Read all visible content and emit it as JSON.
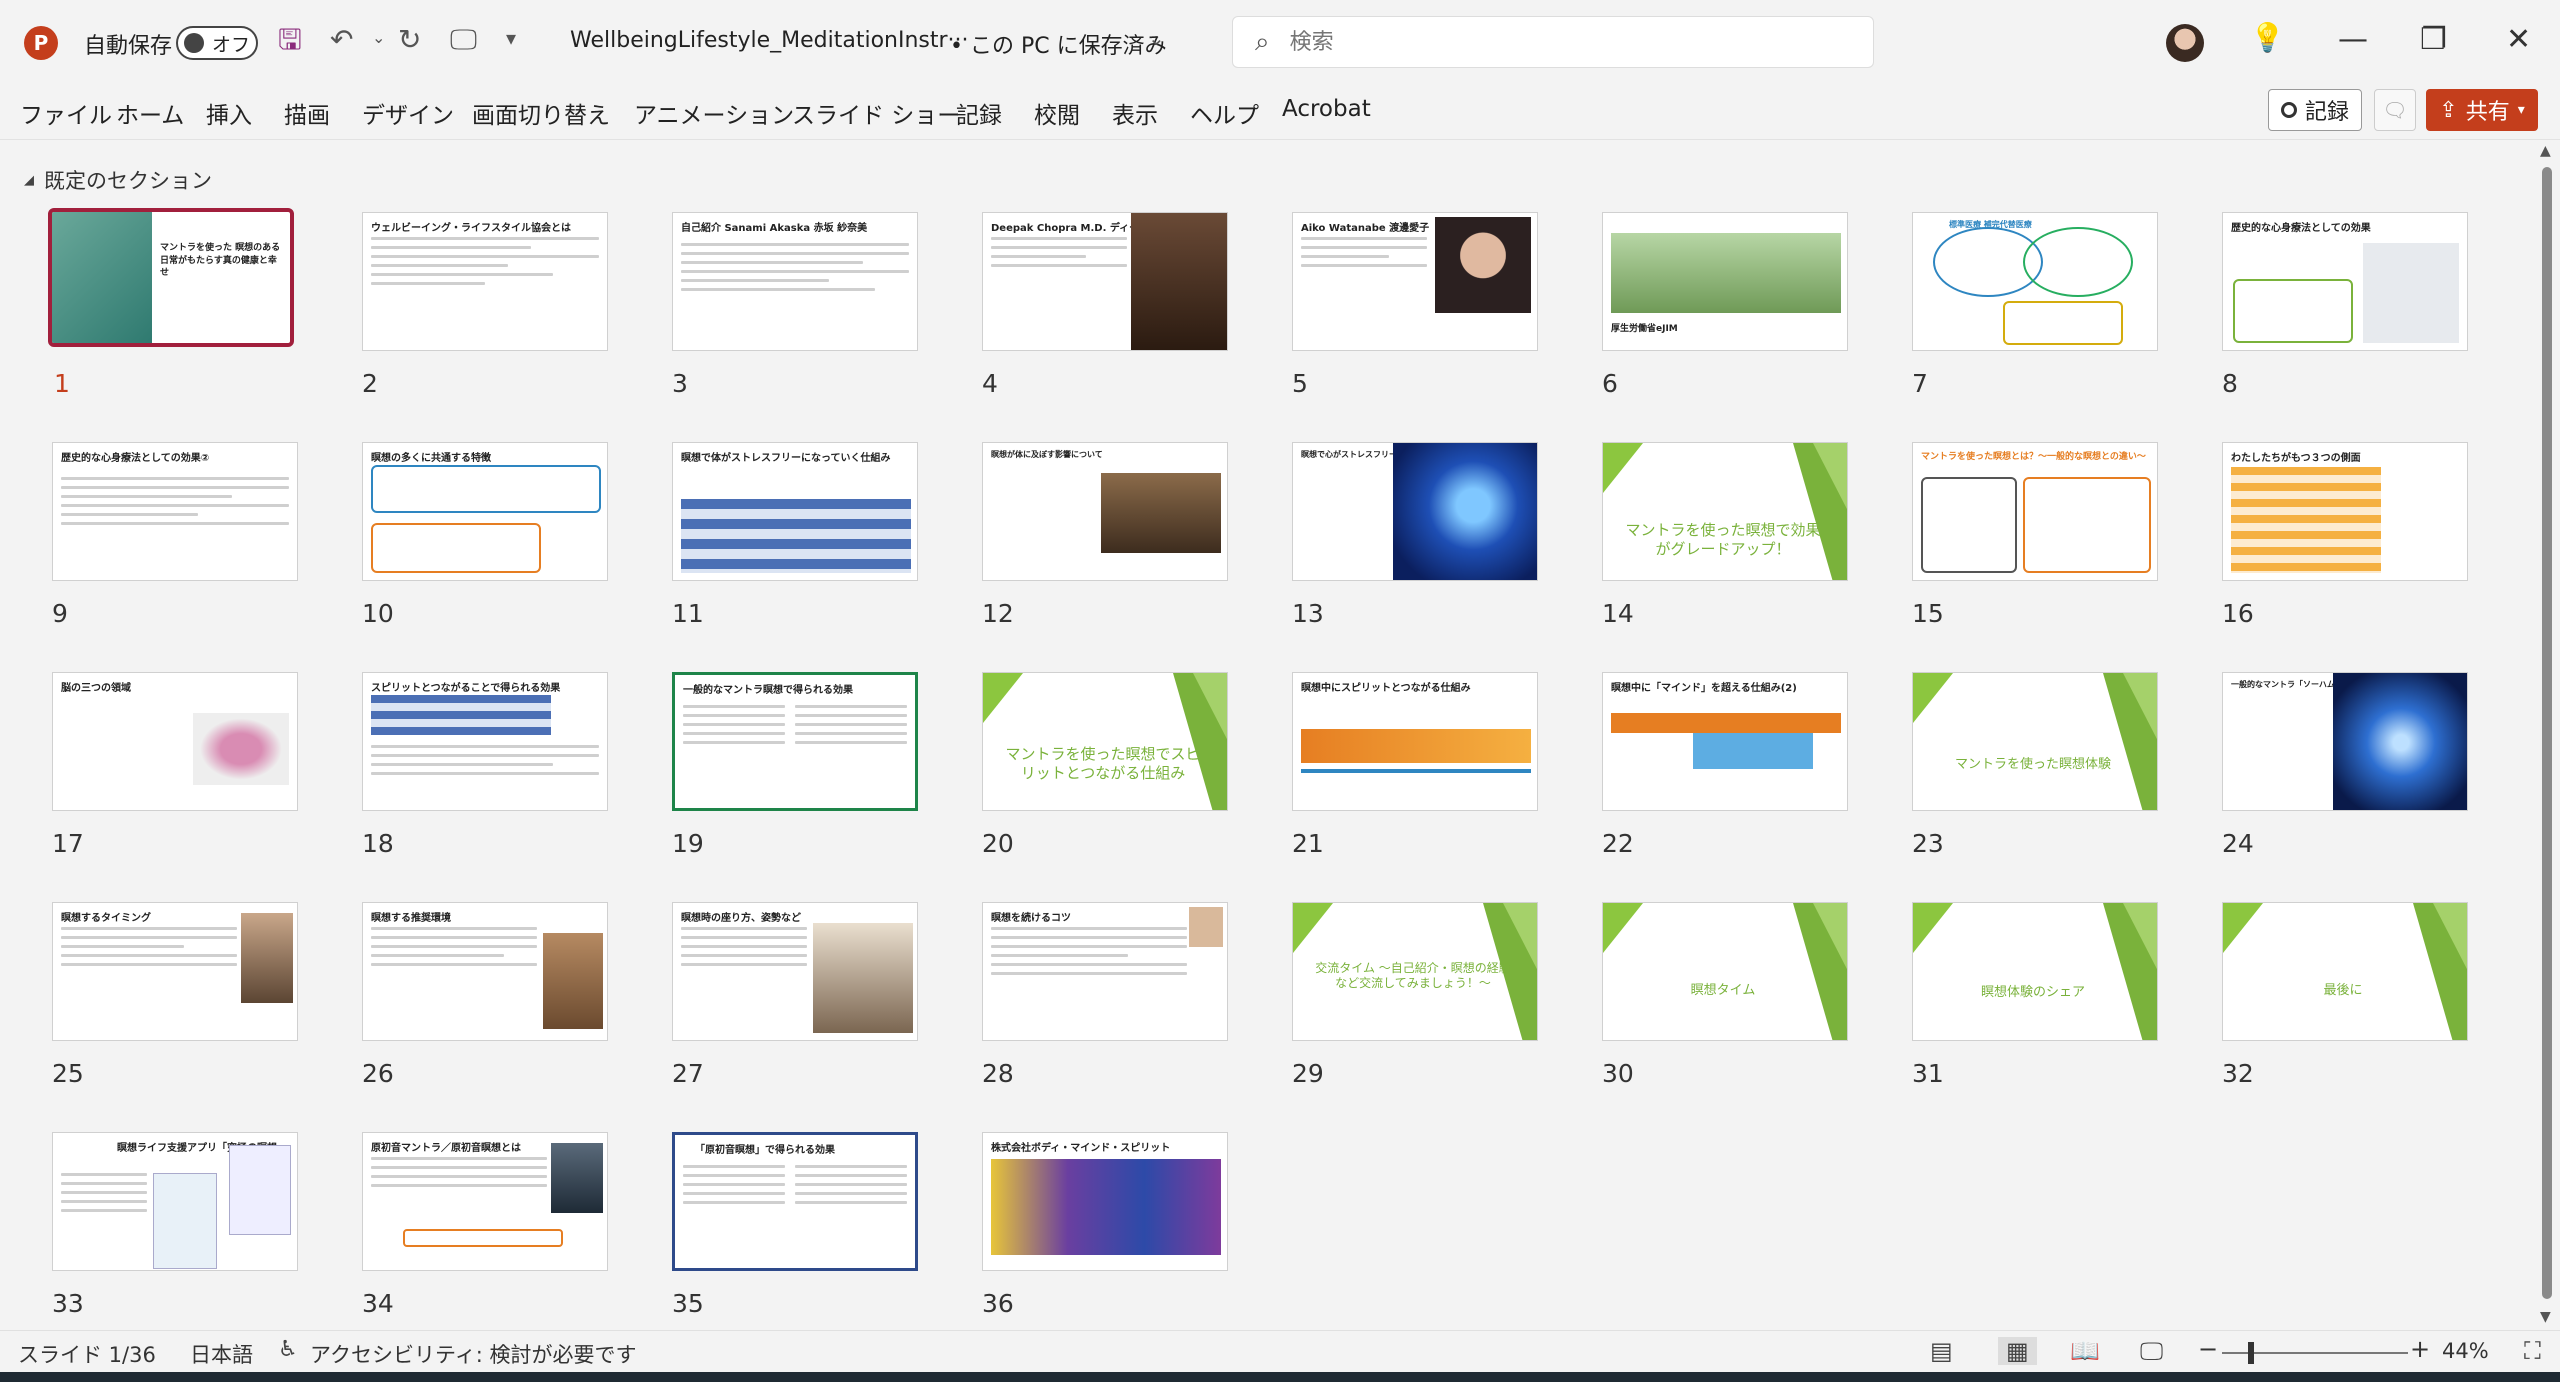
{
  "titlebar": {
    "autosave_label": "自動保存",
    "autosave_state": "オフ",
    "filename": "WellbeingLifestyle_MeditationInstr···",
    "save_status": "• この PC に保存済み",
    "search_placeholder": "検索"
  },
  "menu": {
    "items": [
      "ファイル",
      "ホーム",
      "挿入",
      "描画",
      "デザイン",
      "画面切り替え",
      "アニメーション",
      "スライド ショー",
      "記録",
      "校閲",
      "表示",
      "ヘルプ",
      "Acrobat"
    ],
    "record_label": "記録",
    "share_label": "共有"
  },
  "section": {
    "name": "既定のセクション"
  },
  "slides": [
    {
      "n": "1",
      "title": "マントラを使った 瞑想のある日常がもたらす真の健康と幸せ"
    },
    {
      "n": "2",
      "title": "ウェルビーイング・ライフスタイル協会とは"
    },
    {
      "n": "3",
      "title": "自己紹介 Sanami Akaska 赤坂 紗奈美"
    },
    {
      "n": "4",
      "title": "Deepak Chopra M.D. ディーパック・チョプラ"
    },
    {
      "n": "5",
      "title": "Aiko Watanabe 渡邊愛子"
    },
    {
      "n": "6",
      "title": "厚生労働省eJIM"
    },
    {
      "n": "7",
      "title": "標準医療 補完代替医療"
    },
    {
      "n": "8",
      "title": "歴史的な心身療法としての効果"
    },
    {
      "n": "9",
      "title": "歴史的な心身療法としての効果②"
    },
    {
      "n": "10",
      "title": "瞑想の多くに共通する特徴"
    },
    {
      "n": "11",
      "title": "瞑想で体がストレスフリーになっていく仕組み"
    },
    {
      "n": "12",
      "title": "瞑想が体に及ぼす影響について"
    },
    {
      "n": "13",
      "title": "瞑想で心がストレスフリーになっていく仕組み"
    },
    {
      "n": "14",
      "title": "マントラを使った瞑想で効果がグレードアップ！"
    },
    {
      "n": "15",
      "title": "マントラを使った瞑想とは？〜一般的な瞑想との違い〜"
    },
    {
      "n": "16",
      "title": "わたしたちがもつ３つの側面"
    },
    {
      "n": "17",
      "title": "脳の三つの領域"
    },
    {
      "n": "18",
      "title": "スピリットとつながることで得られる効果"
    },
    {
      "n": "19",
      "title": "一般的なマントラ瞑想で得られる効果"
    },
    {
      "n": "20",
      "title": "マントラを使った瞑想でスピリットとつながる仕組み"
    },
    {
      "n": "21",
      "title": "瞑想中にスピリットとつながる仕組み"
    },
    {
      "n": "22",
      "title": "瞑想中に「マインド」を超える仕組み(2)"
    },
    {
      "n": "23",
      "title": "マントラを使った瞑想体験"
    },
    {
      "n": "24",
      "title": "一般的なマントラ「ソーハム」と「アーハム」"
    },
    {
      "n": "25",
      "title": "瞑想するタイミング"
    },
    {
      "n": "26",
      "title": "瞑想する推奨環境"
    },
    {
      "n": "27",
      "title": "瞑想時の座り方、姿勢など"
    },
    {
      "n": "28",
      "title": "瞑想を続けるコツ"
    },
    {
      "n": "29",
      "title": "交流タイム 〜自己紹介・瞑想の経験など交流してみましょう！〜"
    },
    {
      "n": "30",
      "title": "瞑想タイム"
    },
    {
      "n": "31",
      "title": "瞑想体験のシェア"
    },
    {
      "n": "32",
      "title": "最後に"
    },
    {
      "n": "33",
      "title": "瞑想ライフ支援アプリ「究極の瞑想」"
    },
    {
      "n": "34",
      "title": "原初音マントラ／原初音瞑想とは"
    },
    {
      "n": "35",
      "title": "「原初音瞑想」で得られる効果"
    },
    {
      "n": "36",
      "title": "株式会社ボディ・マインド・スピリット"
    }
  ],
  "status": {
    "slide_pos": "スライド 1/36",
    "language": "日本語",
    "accessibility": "アクセシビリティ: 検討が必要です",
    "zoom": "44%"
  },
  "colors": {
    "accent": "#c43e1c",
    "selected_border": "#a11f3c",
    "green": "#7ab23b"
  }
}
